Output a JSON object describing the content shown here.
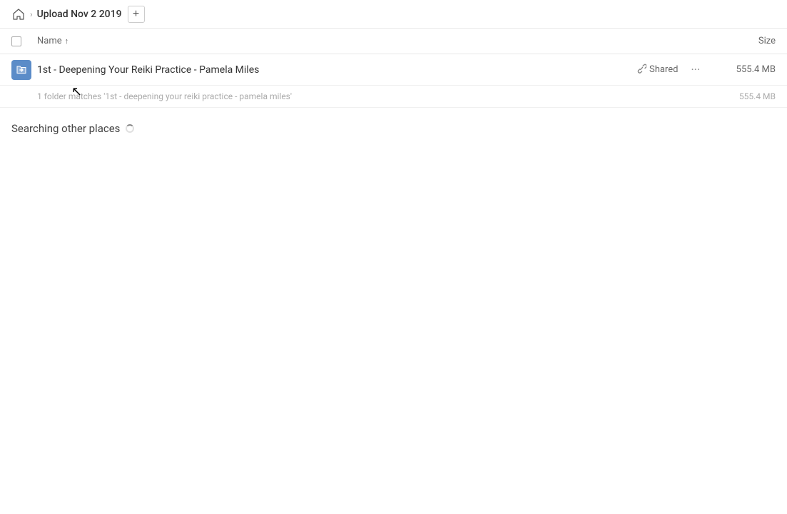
{
  "topbar": {
    "breadcrumb_title": "Upload Nov 2 2019",
    "add_button_label": "+"
  },
  "columns": {
    "name_label": "Name",
    "sort_indicator": "↑",
    "size_label": "Size"
  },
  "file_row": {
    "name": "1st - Deepening Your Reiki Practice - Pamela Miles",
    "shared_label": "Shared",
    "size": "555.4 MB",
    "more_button": "···"
  },
  "match_info": {
    "text": "1 folder matches '1st - deepening your reiki practice - pamela miles'",
    "size": "555.4 MB"
  },
  "searching": {
    "title": "Searching other places"
  }
}
